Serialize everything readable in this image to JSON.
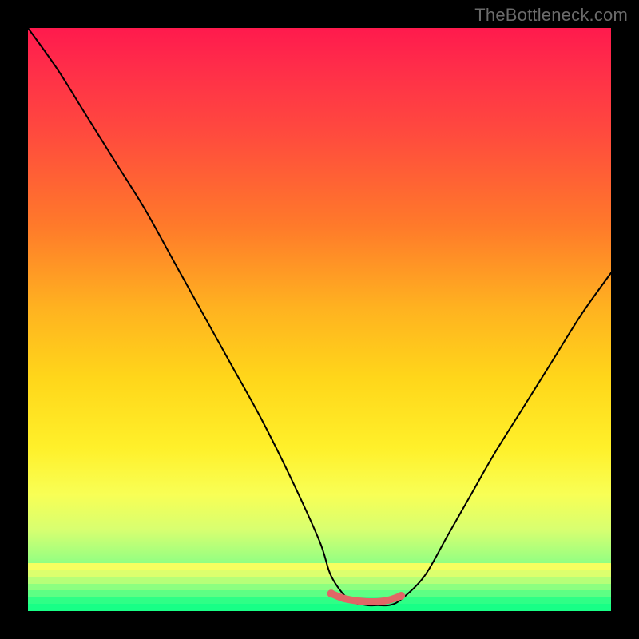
{
  "watermark": "TheBottleneck.com",
  "chart_data": {
    "type": "line",
    "title": "",
    "xlabel": "",
    "ylabel": "",
    "xlim": [
      0,
      100
    ],
    "ylim": [
      0,
      100
    ],
    "grid": false,
    "legend": false,
    "series": [
      {
        "name": "bottleneck-curve",
        "x": [
          0,
          5,
          10,
          15,
          20,
          25,
          30,
          35,
          40,
          45,
          50,
          52,
          55,
          58,
          60,
          62,
          64,
          68,
          72,
          76,
          80,
          85,
          90,
          95,
          100
        ],
        "values": [
          100,
          93,
          85,
          77,
          69,
          60,
          51,
          42,
          33,
          23,
          12,
          6,
          2,
          1,
          1,
          1,
          2,
          6,
          13,
          20,
          27,
          35,
          43,
          51,
          58
        ]
      },
      {
        "name": "optimal-range-marker",
        "x": [
          52,
          54,
          56,
          58,
          60,
          62,
          64
        ],
        "values": [
          3.0,
          2.2,
          1.8,
          1.6,
          1.6,
          1.9,
          2.6
        ]
      }
    ],
    "colors": {
      "curve": "#000000",
      "marker": "#e06666",
      "gradient_top": "#ff1a4d",
      "gradient_bottom": "#1aff86"
    },
    "bottom_bands": [
      "#f5ff60",
      "#dcff6e",
      "#b6ff78",
      "#8cff80",
      "#5eff84",
      "#2fff86",
      "#18ff86"
    ]
  }
}
